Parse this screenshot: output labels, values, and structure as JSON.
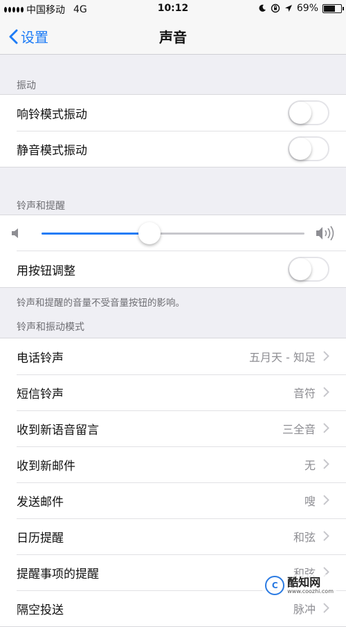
{
  "status_bar": {
    "carrier": "中国移动",
    "network": "4G",
    "time": "10:12",
    "battery_percent": "69%",
    "battery_level": 0.69
  },
  "nav": {
    "back_label": "设置",
    "title": "声音"
  },
  "vibration": {
    "header": "振动",
    "rows": [
      {
        "label": "响铃模式振动",
        "on": false
      },
      {
        "label": "静音模式振动",
        "on": false
      }
    ]
  },
  "ringer": {
    "header": "铃声和提醒",
    "volume_level": 0.41,
    "adjust_label": "用按钮调整",
    "adjust_on": false,
    "footnote": "铃声和提醒的音量不受音量按钮的影响。"
  },
  "patterns": {
    "header": "铃声和振动模式",
    "rows": [
      {
        "label": "电话铃声",
        "value": "五月天 - 知足"
      },
      {
        "label": "短信铃声",
        "value": "音符"
      },
      {
        "label": "收到新语音留言",
        "value": "三全音"
      },
      {
        "label": "收到新邮件",
        "value": "无"
      },
      {
        "label": "发送邮件",
        "value": "嗖"
      },
      {
        "label": "日历提醒",
        "value": "和弦"
      },
      {
        "label": "提醒事项的提醒",
        "value": "和弦"
      },
      {
        "label": "隔空投送",
        "value": "脉冲"
      }
    ]
  },
  "watermark": {
    "logo": "C",
    "name": "酷知网",
    "url": "www.coozhi.com"
  },
  "colors": {
    "accent": "#1e7cf6",
    "background": "#efeff4"
  }
}
